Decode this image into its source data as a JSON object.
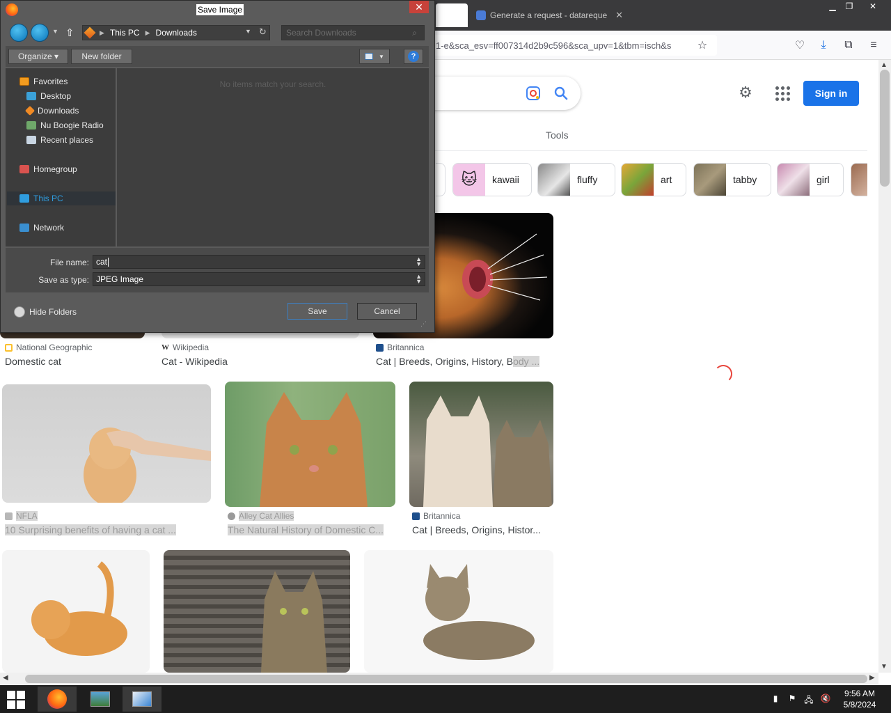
{
  "browser": {
    "tab_title": "Generate a request - datareque",
    "url": "1-e&sca_esv=ff007314d2b9c596&sca_upv=1&tbm=isch&s",
    "window_controls": [
      "minimize-icon",
      "restore-icon",
      "close-icon"
    ]
  },
  "google": {
    "tools_label": "Tools",
    "sign_in_label": "Sign in",
    "chips": [
      {
        "label": "kawaii",
        "icon": "kawaii-cat-icon"
      },
      {
        "label": "fluffy",
        "icon": "fluffy-cat-thumb"
      },
      {
        "label": "art",
        "icon": "taco-cat-art-thumb"
      },
      {
        "label": "tabby",
        "icon": "tabby-cat-thumb"
      },
      {
        "label": "girl",
        "icon": "girl-cat-thumb"
      }
    ],
    "results_row1": [
      {
        "source": "National Geographic",
        "title": "Domestic cat"
      },
      {
        "source": "Wikipedia",
        "title": "Cat - Wikipedia"
      },
      {
        "source": "Britannica",
        "title": "Cat | Breeds, Origins, History, B",
        "title_dim": "ody ..."
      }
    ],
    "results_row2": [
      {
        "source": "NFLA",
        "title": "10 Surprising benefits of having a cat ..."
      },
      {
        "source": "Alley Cat Allies",
        "title": "The Natural History of Domestic C..."
      },
      {
        "source": "Britannica",
        "title": "Cat | Breeds, Origins, Histor..."
      }
    ]
  },
  "dialog": {
    "title": "Save Image",
    "breadcrumb": [
      "This PC",
      "Downloads"
    ],
    "search_placeholder": "Search Downloads",
    "toolbar": {
      "organize": "Organize ▾",
      "new_folder": "New folder"
    },
    "nav": {
      "favorites": "Favorites",
      "desktop": "Desktop",
      "downloads": "Downloads",
      "nu_boogie": "Nu Boogie Radio",
      "recent": "Recent places",
      "homegroup": "Homegroup",
      "this_pc": "This PC",
      "network": "Network"
    },
    "empty_message": "No items match your search.",
    "file_name_label": "File name:",
    "file_name_value": "cat",
    "save_type_label": "Save as type:",
    "save_type_value": "JPEG Image",
    "hide_folders": "Hide Folders",
    "save_label": "Save",
    "cancel_label": "Cancel"
  },
  "taskbar": {
    "time": "9:56 AM",
    "date": "5/8/2024"
  },
  "colors": {
    "google_blue": "#1a73e8",
    "dialog_bg": "#5b5b5b",
    "close_red": "#c7423a",
    "taskbar": "#1e1e1e"
  }
}
